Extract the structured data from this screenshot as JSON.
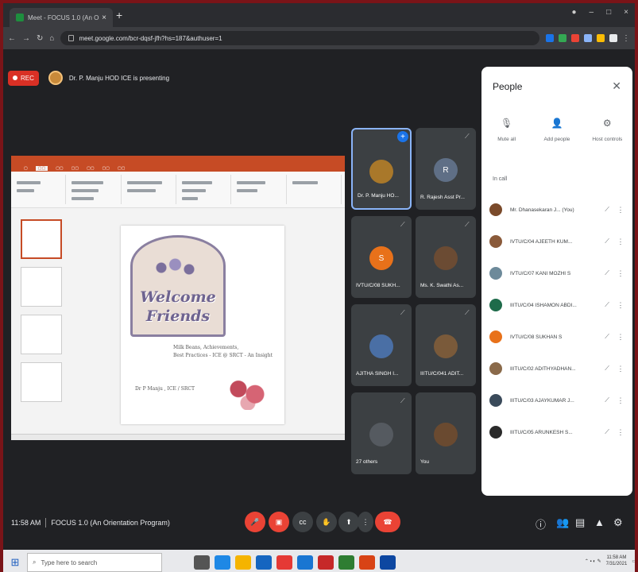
{
  "browser": {
    "tab_title": "Meet - FOCUS 1.0 (An Orientation",
    "url": "meet.google.com/bcr-dqsf-jfh?hs=187&authuser=1"
  },
  "meet": {
    "rec_label": "REC",
    "presenting_text": "Dr. P. Manju HOD ICE is presenting",
    "time": "11:58 AM",
    "meeting_name": "FOCUS 1.0 (An Orientation Program)"
  },
  "slide": {
    "welcome": "Welcome",
    "friends": "Friends",
    "line1": "Milk Beans, Achievements,",
    "line2": "Best Practices - ICE @ SRCT - An Insight",
    "presenter": "Dr P Manju , ICE / SRCT"
  },
  "tiles": [
    {
      "name": "Dr. P. Manju HO...",
      "initial": "",
      "color": "#a9782a"
    },
    {
      "name": "R. Rajesh Asst Pr...",
      "initial": "R",
      "color": "#5f6f86"
    },
    {
      "name": "IVTU/C/08 SUKH...",
      "initial": "S",
      "color": "#e8711a"
    },
    {
      "name": "Ms. K. Swathi As...",
      "initial": "",
      "color": "#6b4b33"
    },
    {
      "name": "AJITHA SINGH I...",
      "initial": "",
      "color": "#4a6fa5"
    },
    {
      "name": "IIITU/C/041 ADIT...",
      "initial": "",
      "color": "#7a5a3a"
    },
    {
      "name": "27 others",
      "initial": "",
      "color": "#555a60"
    },
    {
      "name": "You",
      "initial": "",
      "color": "#6a4a30"
    }
  ],
  "people": {
    "title": "People",
    "actions": [
      {
        "label": "Mute all",
        "icon": "🎙"
      },
      {
        "label": "Add people",
        "icon": "👤"
      },
      {
        "label": "Host controls",
        "icon": "⚙"
      }
    ],
    "in_call_label": "In call",
    "list": [
      {
        "name": "Mr. Dhanasekaran J... (You)",
        "color": "#7a4a2a"
      },
      {
        "name": "IVTU/C/04 AJEETH KUM...",
        "color": "#8a5a3a"
      },
      {
        "name": "IVTU/C/07 KANI MOZHI S",
        "color": "#6d8a9a"
      },
      {
        "name": "IIITU/C/04 ISHAMON ABDI...",
        "color": "#1e6b4a"
      },
      {
        "name": "IVTU/C/08 SUKHAN S",
        "color": "#e8711a"
      },
      {
        "name": "IIITU/C/02 ADITHYADHAN...",
        "color": "#8a6a4a"
      },
      {
        "name": "IIITU/C/03 AJAYKUMAR J...",
        "color": "#3a4a5a"
      },
      {
        "name": "IIITU/C/05 ARUNKESH S...",
        "color": "#2a2a2a"
      }
    ]
  },
  "taskbar": {
    "search_placeholder": "Type here to search",
    "time": "11:58 AM",
    "date": "7/31/2021"
  }
}
